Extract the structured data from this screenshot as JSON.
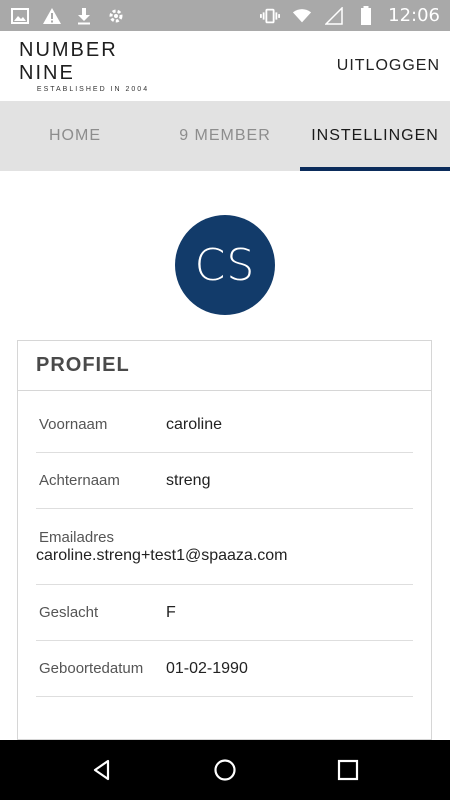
{
  "status_bar": {
    "time": "12:06",
    "left_icons": [
      "image-icon",
      "warning-icon",
      "download-icon",
      "settings-puzzle-icon"
    ],
    "right_icons": [
      "vibrate-icon",
      "wifi-icon",
      "signal-icon",
      "battery-icon"
    ]
  },
  "header": {
    "logo_main": "NUMBER NINE",
    "logo_sub": "ESTABLISHED IN 2004",
    "logout_label": "UITLOGGEN"
  },
  "tabs": [
    {
      "label": "HOME",
      "active": false
    },
    {
      "label": "9 MEMBER",
      "active": false
    },
    {
      "label": "INSTELLINGEN",
      "active": true
    }
  ],
  "avatar": {
    "initials": "CS",
    "color": "#123b6a"
  },
  "profile": {
    "title": "PROFIEL",
    "fields": [
      {
        "label": "Voornaam",
        "value": "caroline"
      },
      {
        "label": "Achternaam",
        "value": "streng"
      },
      {
        "label": "Emailadres",
        "value": "caroline.streng+test1@spaaza.com"
      },
      {
        "label": "Geslacht",
        "value": "F"
      },
      {
        "label": "Geboortedatum",
        "value": "01-02-1990"
      }
    ]
  },
  "nav": {
    "buttons": [
      "back-icon",
      "home-icon",
      "recents-icon"
    ]
  },
  "colors": {
    "accent": "#0b2c5b",
    "status_bar": "#a9a9a9",
    "tab_bg": "#e2e2e2"
  }
}
